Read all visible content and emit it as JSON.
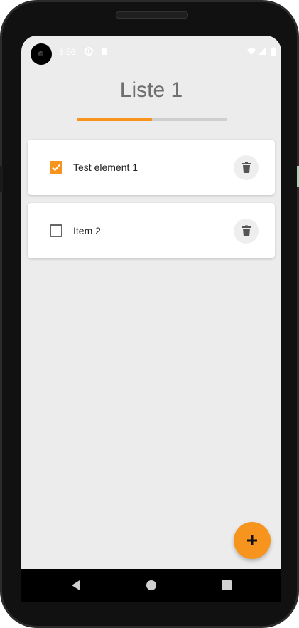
{
  "status_bar": {
    "time": "8:56",
    "icons": [
      "data-saver-icon",
      "sd-card-icon",
      "wifi-icon",
      "signal-icon",
      "battery-icon"
    ]
  },
  "list": {
    "title": "Liste 1",
    "progress": 0.5,
    "items": [
      {
        "label": "Test element 1",
        "checked": true
      },
      {
        "label": "Item 2",
        "checked": false
      }
    ]
  },
  "fab": {
    "icon": "plus-icon"
  },
  "nav_bar": {
    "buttons": [
      "back-icon",
      "home-icon",
      "recents-icon"
    ]
  },
  "colors": {
    "accent": "#f7941d",
    "background": "#ececec",
    "card": "#ffffff",
    "title_text": "#6f6f6f"
  }
}
